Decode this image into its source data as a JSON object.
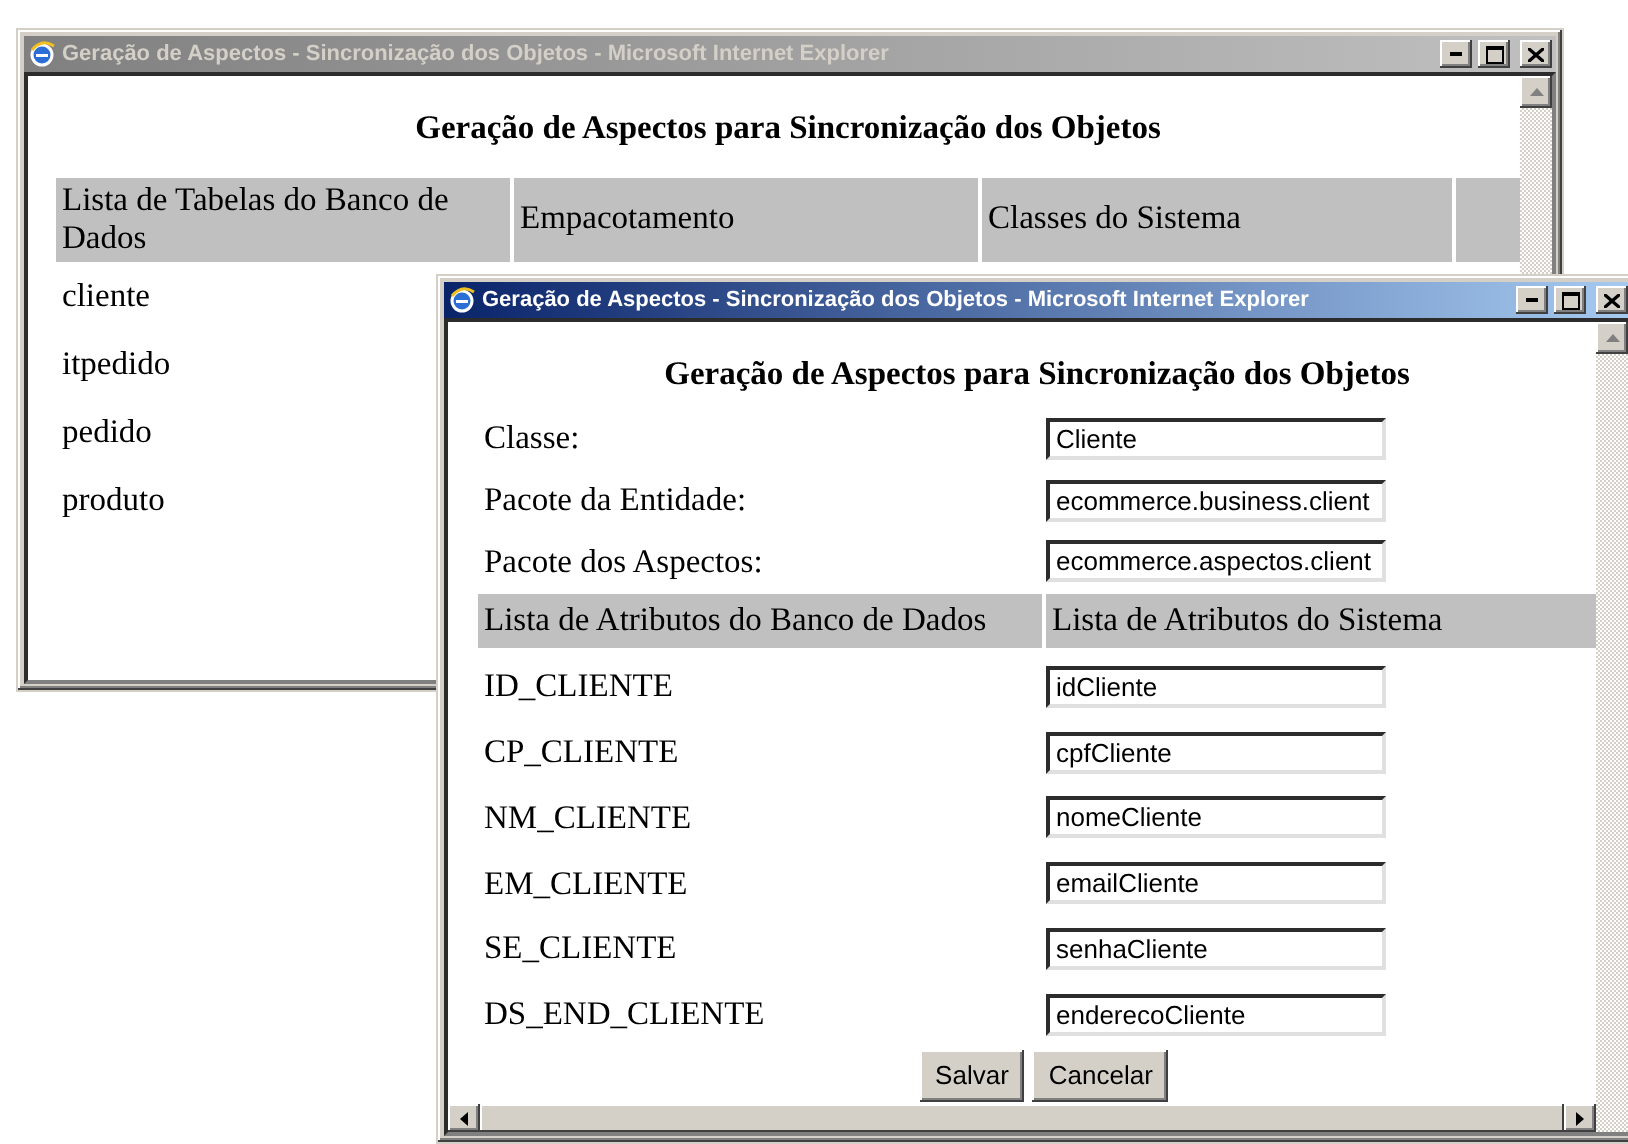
{
  "back_window": {
    "title": "Geração de Aspectos - Sincronização dos Objetos - Microsoft Internet Explorer",
    "active": false,
    "heading": "Geração de Aspectos para Sincronização dos Objetos",
    "table": {
      "columns": [
        "Lista de Tabelas do Banco de Dados",
        "Empacotamento",
        "Classes do Sistema"
      ],
      "rows": [
        "cliente",
        "itpedido",
        "pedido",
        "produto"
      ]
    }
  },
  "front_window": {
    "title": "Geração de Aspectos - Sincronização dos Objetos - Microsoft Internet Explorer",
    "active": true,
    "heading": "Geração de Aspectos para Sincronização dos Objetos",
    "fields": [
      {
        "label": "Classe:",
        "value": "Cliente"
      },
      {
        "label": "Pacote da Entidade:",
        "value": "ecommerce.business.client"
      },
      {
        "label": "Pacote dos Aspectos:",
        "value": "ecommerce.aspectos.client"
      }
    ],
    "table": {
      "columns": [
        "Lista de Atributos do Banco de Dados",
        "Lista de Atributos do Sistema"
      ],
      "rows": [
        {
          "attribute": "ID_CLIENTE",
          "value": "idCliente"
        },
        {
          "attribute": "CP_CLIENTE",
          "value": "cpfCliente"
        },
        {
          "attribute": "NM_CLIENTE",
          "value": "nomeCliente"
        },
        {
          "attribute": "EM_CLIENTE",
          "value": "emailCliente"
        },
        {
          "attribute": "SE_CLIENTE",
          "value": "senhaCliente"
        },
        {
          "attribute": "DS_END_CLIENTE",
          "value": "enderecoCliente"
        }
      ]
    },
    "buttons": [
      "Salvar",
      "Cancelar"
    ]
  }
}
